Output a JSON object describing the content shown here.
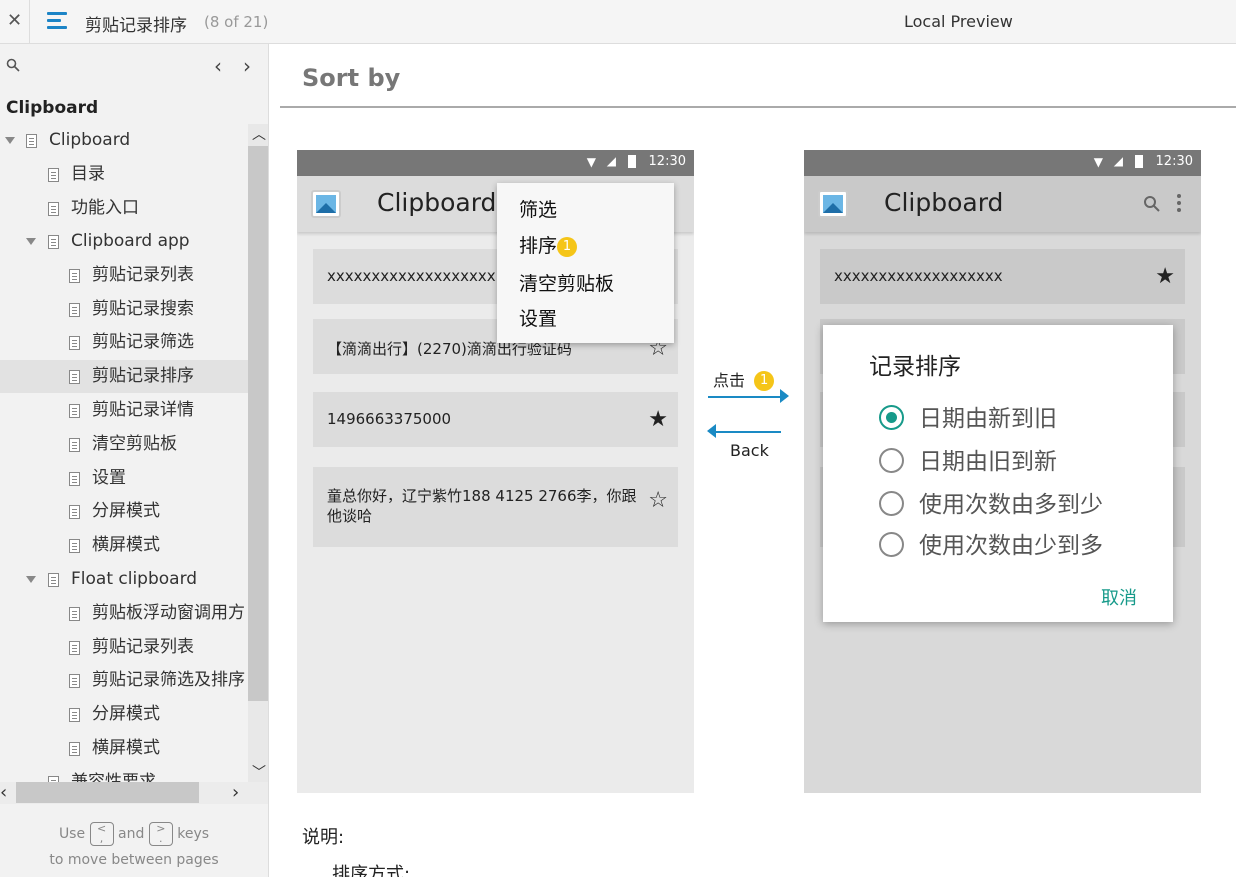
{
  "topbar": {
    "close_glyph": "✕",
    "doc_title": "剪贴记录排序",
    "page_count": "(8 of 21)",
    "preview_label": "Local Preview",
    "accent_color": "#1c84c6"
  },
  "sidebar": {
    "heading": "Clipboard",
    "prev_glyph": "‹",
    "next_glyph": "›",
    "items": [
      {
        "label": "Clipboard"
      },
      {
        "label": "目录"
      },
      {
        "label": "功能入口"
      },
      {
        "label": "Clipboard app"
      },
      {
        "label": "剪贴记录列表"
      },
      {
        "label": "剪贴记录搜索"
      },
      {
        "label": "剪贴记录筛选"
      },
      {
        "label": "剪贴记录排序"
      },
      {
        "label": "剪贴记录详情"
      },
      {
        "label": "清空剪贴板"
      },
      {
        "label": "设置"
      },
      {
        "label": "分屏模式"
      },
      {
        "label": "横屏模式"
      },
      {
        "label": "Float clipboard"
      },
      {
        "label": "剪贴板浮动窗调用方"
      },
      {
        "label": "剪贴记录列表"
      },
      {
        "label": "剪贴记录筛选及排序"
      },
      {
        "label": "分屏模式"
      },
      {
        "label": "横屏模式"
      },
      {
        "label": "兼容性要求"
      }
    ],
    "hint": {
      "use": "Use",
      "key_prev": "<\n,",
      "and": "and",
      "key_next": ">\n.",
      "keys": "keys",
      "line2": "to move between pages"
    }
  },
  "content": {
    "heading": "Sort by",
    "left_phone": {
      "time": "12:30",
      "app_title": "Clipboard",
      "cards": [
        {
          "text": "xxxxxxxxxxxxxxxxxxx",
          "star": ""
        },
        {
          "text": "【滴滴出行】(2270)滴滴出行验证码",
          "star": "☆"
        },
        {
          "text": "1496663375000",
          "star": "★"
        },
        {
          "text": "童总你好，辽宁紫竹188 4125 2766李，你跟他谈哈",
          "star": "☆"
        }
      ],
      "menu": {
        "items": [
          "筛选",
          "排序",
          "清空剪贴板",
          "设置"
        ],
        "badge": "1"
      }
    },
    "transition": {
      "forward_label": "点击",
      "forward_badge": "1",
      "back_label": "Back"
    },
    "right_phone": {
      "time": "12:30",
      "app_title": "Clipboard",
      "first_card": "xxxxxxxxxxxxxxxxxxx",
      "first_star": "★",
      "dialog": {
        "title": "记录排序",
        "options": [
          "日期由新到旧",
          "日期由旧到新",
          "使用次数由多到少",
          "使用次数由少到多"
        ],
        "selected_index": 0,
        "cancel": "取消",
        "accent_color": "#179a8a"
      }
    },
    "desc_label": "说明:",
    "desc_sub": "排序方式:"
  }
}
